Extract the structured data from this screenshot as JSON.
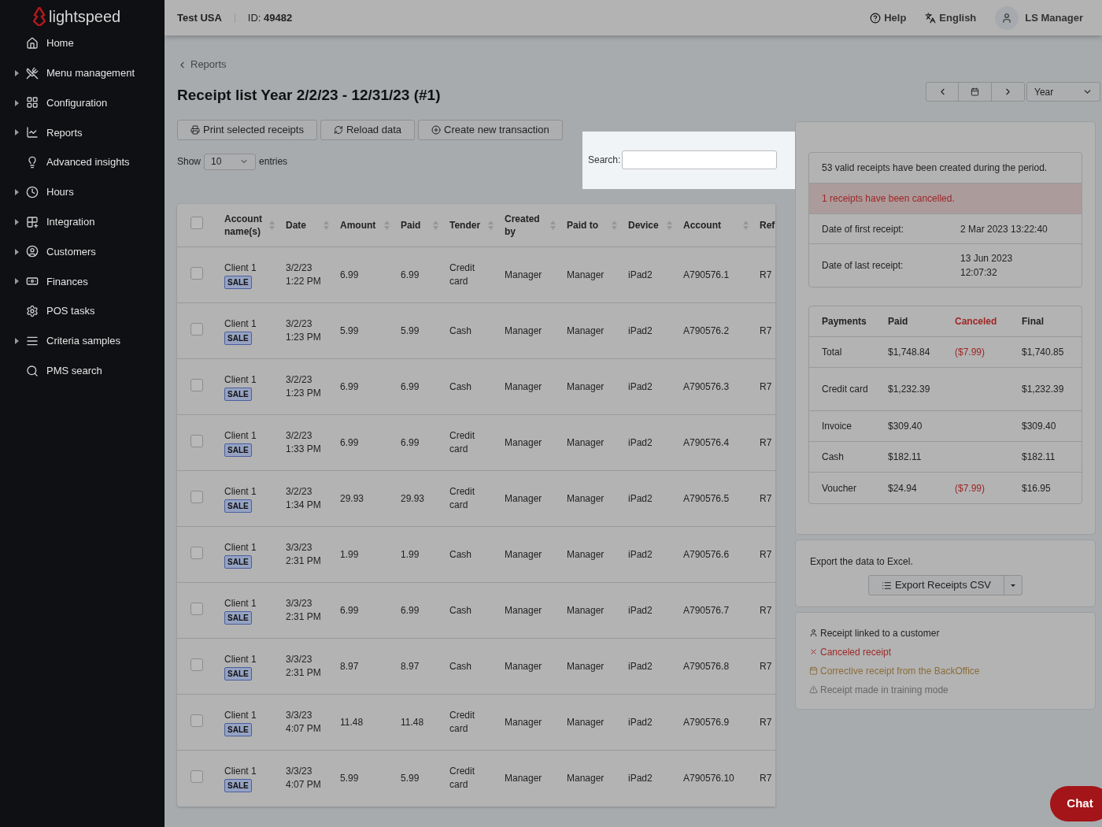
{
  "sidebar": {
    "logo": "lightspeed",
    "items": [
      {
        "label": "Home",
        "expandable": false
      },
      {
        "label": "Menu management",
        "expandable": true
      },
      {
        "label": "Configuration",
        "expandable": true
      },
      {
        "label": "Reports",
        "expandable": true
      },
      {
        "label": "Advanced insights",
        "expandable": false
      },
      {
        "label": "Hours",
        "expandable": true
      },
      {
        "label": "Integration",
        "expandable": true
      },
      {
        "label": "Customers",
        "expandable": true
      },
      {
        "label": "Finances",
        "expandable": true
      },
      {
        "label": "POS tasks",
        "expandable": false
      },
      {
        "label": "Criteria samples",
        "expandable": true
      },
      {
        "label": "PMS search",
        "expandable": false
      }
    ]
  },
  "header": {
    "store": "Test USA",
    "id_label": "ID:",
    "id_value": "49482",
    "help": "Help",
    "language": "English",
    "user": "LS Manager"
  },
  "breadcrumb": "Reports",
  "title": "Receipt list Year 2/2/23 - 12/31/23 (#1)",
  "period": {
    "value": "Year"
  },
  "actions": [
    "Print selected receipts",
    "Reload data",
    "Create new transaction"
  ],
  "length": {
    "before": "Show",
    "value": "10",
    "after": "entries"
  },
  "search": {
    "label": "Search:"
  },
  "table": {
    "all_checked": false,
    "columns": [
      "Account name(s)",
      "Date",
      "Amount",
      "Paid",
      "Tender",
      "Created by",
      "Paid to",
      "Device",
      "Account",
      "Ref"
    ],
    "rows": [
      {
        "checked": false,
        "account": "Client 1",
        "tag": "SALE",
        "date": "3/2/23 1:22 PM",
        "amount": "6.99",
        "paid": "6.99",
        "tender": "Credit card",
        "created_by": "Manager",
        "paid_to": "Manager",
        "device": "iPad2",
        "account_no": "A790576.1",
        "ref": "R7"
      },
      {
        "checked": false,
        "account": "Client 1",
        "tag": "SALE",
        "date": "3/2/23 1:23 PM",
        "amount": "5.99",
        "paid": "5.99",
        "tender": "Cash",
        "created_by": "Manager",
        "paid_to": "Manager",
        "device": "iPad2",
        "account_no": "A790576.2",
        "ref": "R7"
      },
      {
        "checked": false,
        "account": "Client 1",
        "tag": "SALE",
        "date": "3/2/23 1:23 PM",
        "amount": "6.99",
        "paid": "6.99",
        "tender": "Cash",
        "created_by": "Manager",
        "paid_to": "Manager",
        "device": "iPad2",
        "account_no": "A790576.3",
        "ref": "R7"
      },
      {
        "checked": false,
        "account": "Client 1",
        "tag": "SALE",
        "date": "3/2/23 1:33 PM",
        "amount": "6.99",
        "paid": "6.99",
        "tender": "Credit card",
        "created_by": "Manager",
        "paid_to": "Manager",
        "device": "iPad2",
        "account_no": "A790576.4",
        "ref": "R7"
      },
      {
        "checked": false,
        "account": "Client 1",
        "tag": "SALE",
        "date": "3/2/23 1:34 PM",
        "amount": "29.93",
        "paid": "29.93",
        "tender": "Credit card",
        "created_by": "Manager",
        "paid_to": "Manager",
        "device": "iPad2",
        "account_no": "A790576.5",
        "ref": "R7"
      },
      {
        "checked": false,
        "account": "Client 1",
        "tag": "SALE",
        "date": "3/3/23 2:31 PM",
        "amount": "1.99",
        "paid": "1.99",
        "tender": "Cash",
        "created_by": "Manager",
        "paid_to": "Manager",
        "device": "iPad2",
        "account_no": "A790576.6",
        "ref": "R7"
      },
      {
        "checked": false,
        "account": "Client 1",
        "tag": "SALE",
        "date": "3/3/23 2:31 PM",
        "amount": "6.99",
        "paid": "6.99",
        "tender": "Cash",
        "created_by": "Manager",
        "paid_to": "Manager",
        "device": "iPad2",
        "account_no": "A790576.7",
        "ref": "R7"
      },
      {
        "checked": false,
        "account": "Client 1",
        "tag": "SALE",
        "date": "3/3/23 2:31 PM",
        "amount": "8.97",
        "paid": "8.97",
        "tender": "Cash",
        "created_by": "Manager",
        "paid_to": "Manager",
        "device": "iPad2",
        "account_no": "A790576.8",
        "ref": "R7"
      },
      {
        "checked": false,
        "account": "Client 1",
        "tag": "SALE",
        "date": "3/3/23 4:07 PM",
        "amount": "11.48",
        "paid": "11.48",
        "tender": "Credit card",
        "created_by": "Manager",
        "paid_to": "Manager",
        "device": "iPad2",
        "account_no": "A790576.9",
        "ref": "R7"
      },
      {
        "checked": false,
        "account": "Client 1",
        "tag": "SALE",
        "date": "3/3/23 4:07 PM",
        "amount": "5.99",
        "paid": "5.99",
        "tender": "Credit card",
        "created_by": "Manager",
        "paid_to": "Manager",
        "device": "iPad2",
        "account_no": "A790576.10",
        "ref": "R7"
      }
    ]
  },
  "summary": {
    "valid": "53 valid receipts have been created during the period.",
    "cancelled": "1 receipts have been cancelled.",
    "dates": [
      {
        "label": "Date of first receipt:",
        "value": "2 Mar 2023 13:22:40"
      },
      {
        "label": "Date of last receipt:",
        "value": "13 Jun 2023 12:07:32"
      }
    ]
  },
  "payments": {
    "columns": [
      "Payments",
      "Paid",
      "Canceled",
      "Final"
    ],
    "rows": [
      [
        "Total",
        "$1,748.84",
        "($7.99)",
        "$1,740.85"
      ],
      [
        "Credit card",
        "$1,232.39",
        null,
        "$1,232.39"
      ],
      [
        "Invoice",
        "$309.40",
        null,
        "$309.40"
      ],
      [
        "Cash",
        "$182.11",
        null,
        "$182.11"
      ],
      [
        "Voucher",
        "$24.94",
        "($7.99)",
        "$16.95"
      ]
    ]
  },
  "export": {
    "text": "Export the data to Excel.",
    "button": "Export Receipts CSV"
  },
  "legend": [
    {
      "kind": "customer",
      "label": "Receipt linked to a customer"
    },
    {
      "kind": "canceled",
      "label": "Canceled receipt"
    },
    {
      "kind": "corrective",
      "label": "Corrective receipt from the BackOffice"
    },
    {
      "kind": "training",
      "label": "Receipt made in training mode"
    }
  ],
  "chat": "Chat"
}
